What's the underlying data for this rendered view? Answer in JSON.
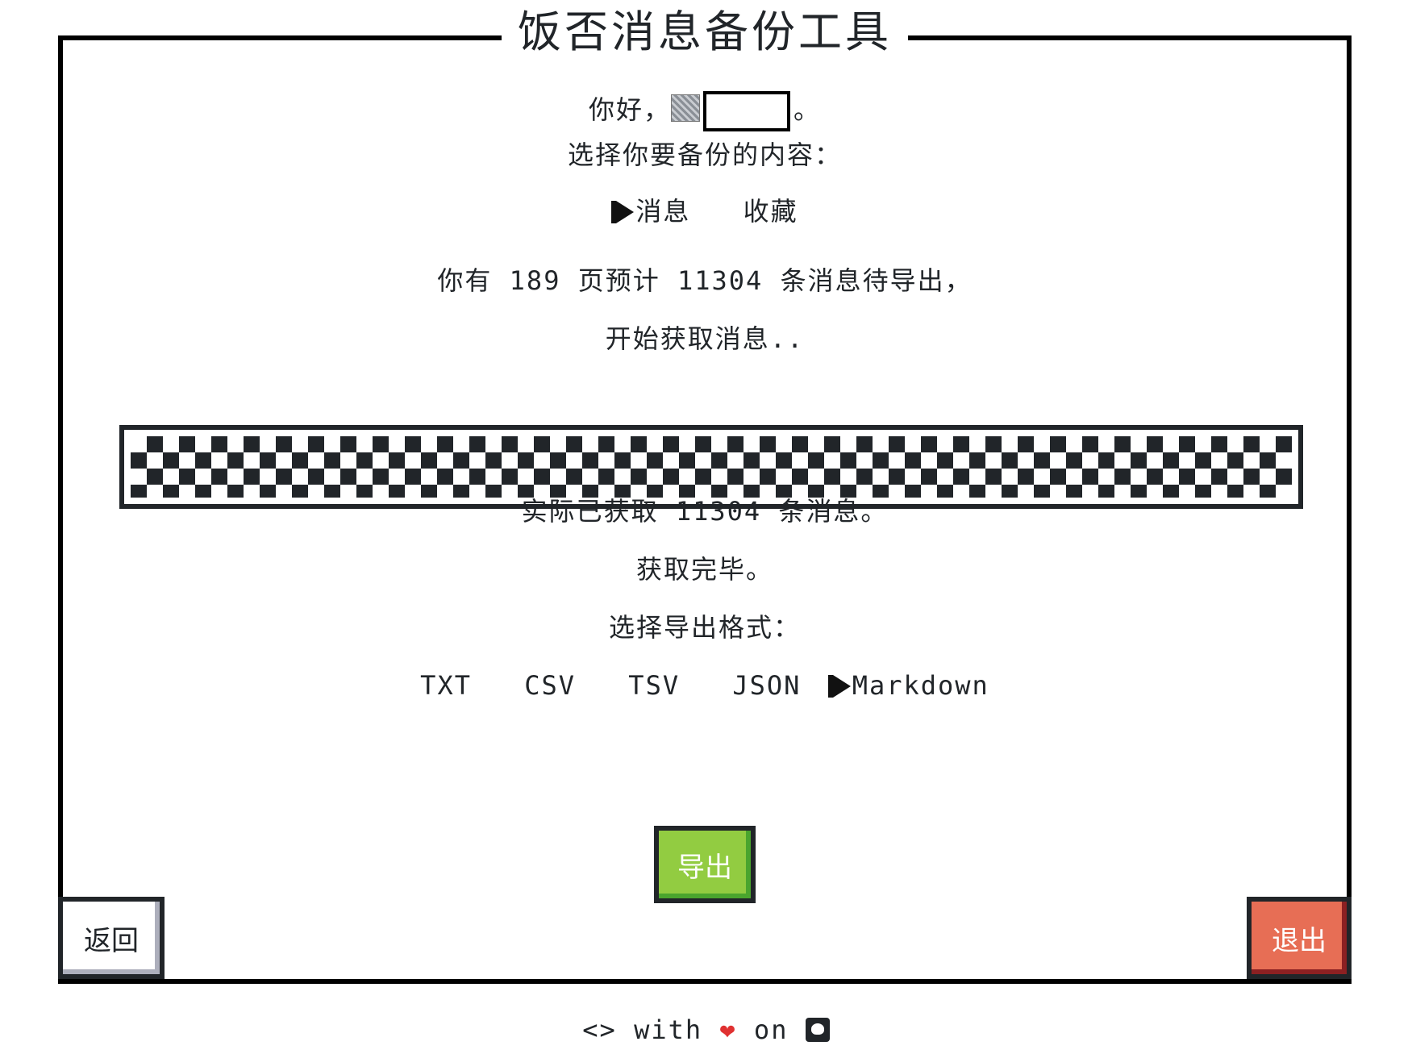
{
  "title": "饭否消息备份工具",
  "greeting": {
    "prefix": "你好，",
    "suffix": "。"
  },
  "content_prompt": "选择你要备份的内容：",
  "content_options": [
    {
      "label": "消息",
      "selected": true
    },
    {
      "label": "收藏",
      "selected": false
    }
  ],
  "summary": "你有 189 页预计 11304 条消息待导出，",
  "fetch_status": "开始获取消息..",
  "progress": {
    "percent": 100
  },
  "fetched": "实际已获取 11304 条消息。",
  "done": "获取完毕。",
  "format_prompt": "选择导出格式：",
  "formats": [
    {
      "label": "TXT",
      "selected": false
    },
    {
      "label": "CSV",
      "selected": false
    },
    {
      "label": "TSV",
      "selected": false
    },
    {
      "label": "JSON",
      "selected": false
    },
    {
      "label": "Markdown",
      "selected": true
    }
  ],
  "buttons": {
    "export": "导出",
    "back": "返回",
    "exit": "退出"
  },
  "footer": {
    "code": "<>",
    "with": "with",
    "on": "on"
  },
  "colors": {
    "export": "#92cc41",
    "exit": "#e76e55",
    "heart": "#e03131"
  }
}
